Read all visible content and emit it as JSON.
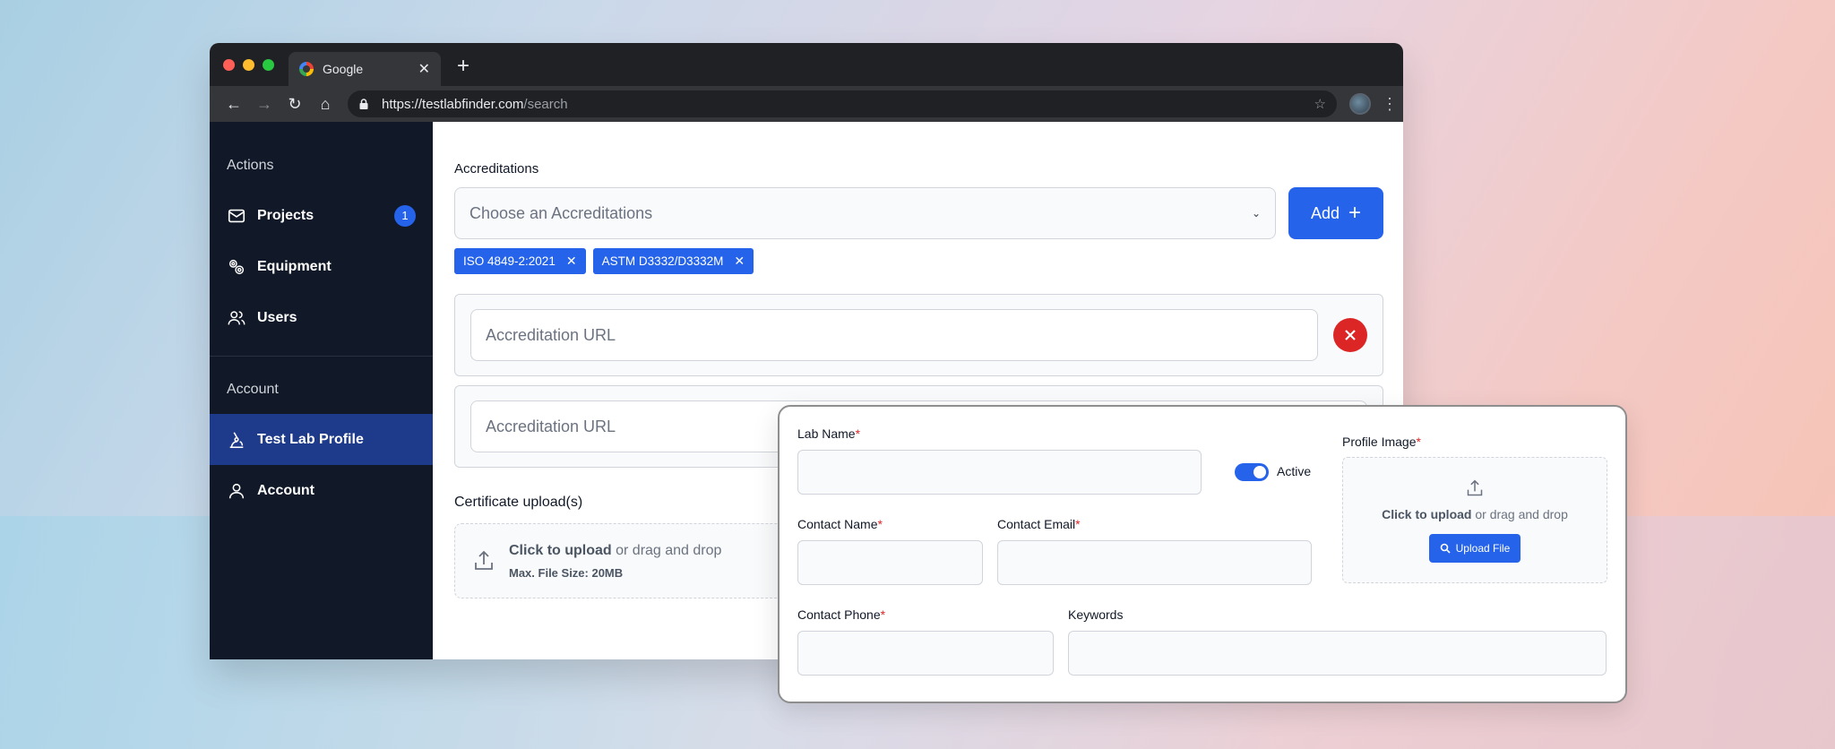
{
  "browser": {
    "tab_title": "Google",
    "new_tab": "+",
    "url_host": "https://testlabfinder.com",
    "url_path": "/search"
  },
  "sidebar": {
    "section_actions": "Actions",
    "items": [
      {
        "label": "Projects",
        "icon": "mail-icon",
        "badge": "1"
      },
      {
        "label": "Equipment",
        "icon": "gears-icon"
      },
      {
        "label": "Users",
        "icon": "users-icon"
      }
    ],
    "section_account": "Account",
    "account_items": [
      {
        "label": "Test Lab Profile",
        "icon": "microscope-icon",
        "active": true
      },
      {
        "label": "Account",
        "icon": "user-icon"
      }
    ]
  },
  "accreditations": {
    "label": "Accreditations",
    "select_placeholder": "Choose an Accreditations",
    "add_label": "Add",
    "chips": [
      "ISO 4849-2:2021",
      "ASTM D3332/D3332M"
    ],
    "url_placeholder": "Accreditation URL"
  },
  "certificate": {
    "label": "Certificate upload(s)",
    "click_text": "Click to upload",
    "drag_text": " or drag and drop",
    "max_size": "Max. File Size: 20MB"
  },
  "form": {
    "lab_name": "Lab Name",
    "active": "Active",
    "profile_image": "Profile Image",
    "contact_name": "Contact Name",
    "contact_email": "Contact Email",
    "contact_phone": "Contact Phone",
    "keywords": "Keywords",
    "required_mark": "*",
    "upload_click": "Click to upload",
    "upload_drag": " or drag and drop",
    "upload_button": "Upload File"
  },
  "colors": {
    "accent": "#2563eb",
    "sidebar_bg": "#111827",
    "danger": "#dc2626"
  }
}
